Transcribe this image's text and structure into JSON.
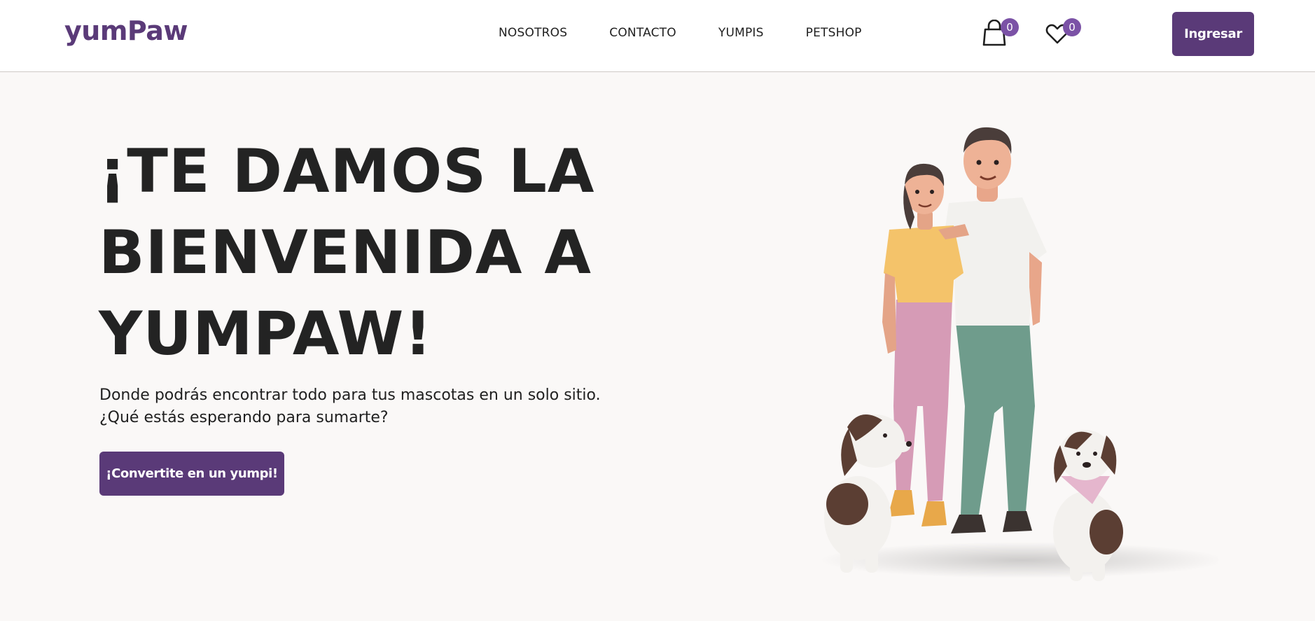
{
  "header": {
    "logo": "yumPaw",
    "nav": [
      {
        "label": "NOSOTROS"
      },
      {
        "label": "CONTACTO"
      },
      {
        "label": "YUMPIS"
      },
      {
        "label": "PETSHOP"
      }
    ],
    "cart_count": "0",
    "favorites_count": "0",
    "login_label": "Ingresar"
  },
  "hero": {
    "title_lines": [
      "¡TE DAMOS LA",
      "BIENVENIDA A",
      "YUMPAW!"
    ],
    "subtitle_lines": [
      "Donde podrás encontrar todo para tus mascotas en un solo sitio.",
      "¿Qué estás esperando para sumarte?"
    ],
    "cta_label": "¡Convertite en un yumpi!"
  },
  "colors": {
    "brand": "#5a3a78",
    "badge": "#7b52a6",
    "background": "#faf8f7"
  },
  "icons": [
    "shopping-bag-icon",
    "heart-icon"
  ]
}
